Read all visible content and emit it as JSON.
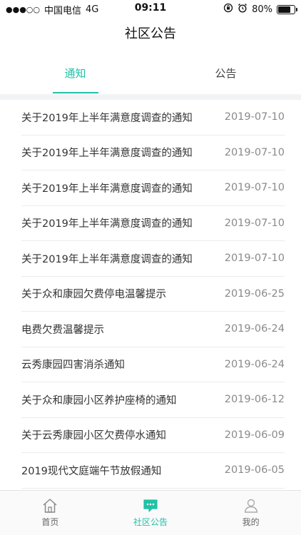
{
  "status_bar": {
    "signal": "●●●○○",
    "carrier": "中国电信",
    "network": "4G",
    "time": "09:11",
    "battery": "80%",
    "battery_level": 0.8
  },
  "header": {
    "title": "社区公告"
  },
  "tabs": [
    {
      "label": "通知",
      "active": true
    },
    {
      "label": "公告",
      "active": false
    }
  ],
  "notices": [
    {
      "title": "关于2019年上半年满意度调查的通知",
      "date": "2019-07-10"
    },
    {
      "title": "关于2019年上半年满意度调查的通知",
      "date": "2019-07-10"
    },
    {
      "title": "关于2019年上半年满意度调查的通知",
      "date": "2019-07-10"
    },
    {
      "title": "关于2019年上半年满意度调查的通知",
      "date": "2019-07-10"
    },
    {
      "title": "关于2019年上半年满意度调查的通知",
      "date": "2019-07-10"
    },
    {
      "title": "关于众和康园欠费停电温馨提示",
      "date": "2019-06-25"
    },
    {
      "title": "电费欠费温馨提示",
      "date": "2019-06-24"
    },
    {
      "title": "云秀康园四害消杀通知",
      "date": "2019-06-24"
    },
    {
      "title": "关于众和康园小区养护座椅的通知",
      "date": "2019-06-12"
    },
    {
      "title": "关于云秀康园小区欠费停水通知",
      "date": "2019-06-09"
    },
    {
      "title": "2019现代文庭端午节放假通知",
      "date": "2019-06-05"
    }
  ],
  "tabbar": {
    "accent_color": "#21c1a6",
    "items": [
      {
        "label": "首页",
        "icon": "home-icon",
        "active": false
      },
      {
        "label": "社区公告",
        "icon": "chat-icon",
        "active": true
      },
      {
        "label": "我的",
        "icon": "user-icon",
        "active": false
      }
    ]
  }
}
